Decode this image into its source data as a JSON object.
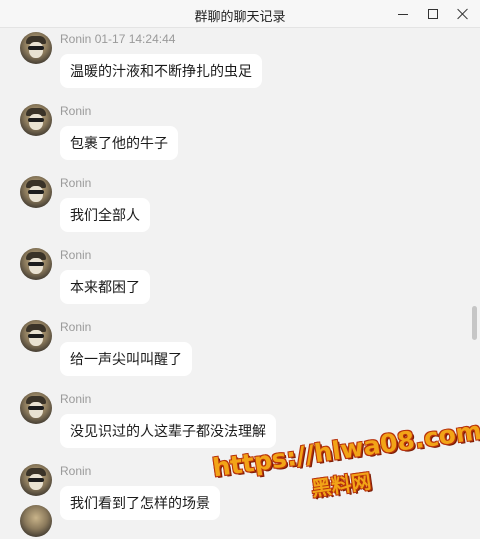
{
  "window": {
    "title": "群聊的聊天记录",
    "minimize_icon": "minimize-icon",
    "maximize_icon": "maximize-icon",
    "close_icon": "close-icon"
  },
  "messages": [
    {
      "sender": "Ronin 01-17 14:24:44",
      "text": "温暖的汁液和不断挣扎的虫足"
    },
    {
      "sender": "Ronin",
      "text": "包裹了他的牛子"
    },
    {
      "sender": "Ronin",
      "text": "我们全部人"
    },
    {
      "sender": "Ronin",
      "text": "本来都困了"
    },
    {
      "sender": "Ronin",
      "text": "给一声尖叫叫醒了"
    },
    {
      "sender": "Ronin",
      "text": "没见识过的人这辈子都没法理解"
    },
    {
      "sender": "Ronin",
      "text": "我们看到了怎样的场景"
    }
  ],
  "watermark": {
    "url": "https://hlwa08.com",
    "name": "黑料网"
  },
  "colors": {
    "background": "#f2f2f2",
    "bubble": "#ffffff",
    "sender_text": "#9a9a9a",
    "watermark_fill": "#f2a417",
    "watermark_outline": "#b8320b"
  }
}
